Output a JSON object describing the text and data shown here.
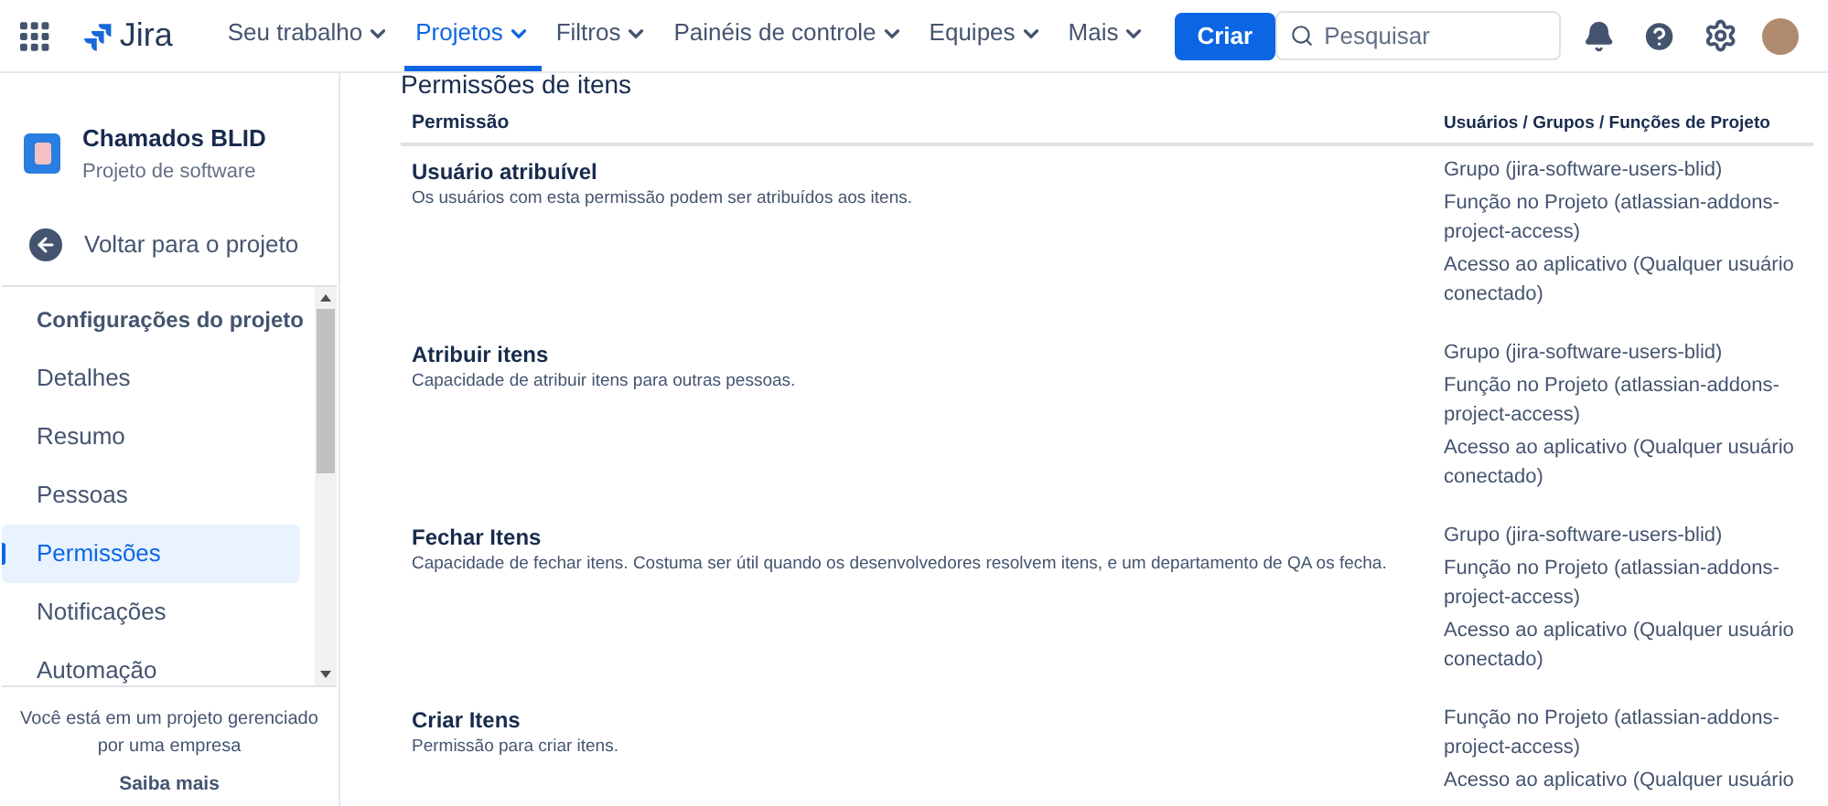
{
  "nav": {
    "product": "Jira",
    "items": [
      {
        "label": "Seu trabalho",
        "selected": false
      },
      {
        "label": "Projetos",
        "selected": true
      },
      {
        "label": "Filtros",
        "selected": false
      },
      {
        "label": "Painéis de controle",
        "selected": false
      },
      {
        "label": "Equipes",
        "selected": false
      },
      {
        "label": "Mais",
        "selected": false
      }
    ],
    "create": "Criar",
    "search": {
      "placeholder": "Pesquisar"
    }
  },
  "sidebar": {
    "project": {
      "name": "Chamados BLID",
      "type": "Projeto de software"
    },
    "back": "Voltar para o projeto",
    "section": "Configurações do projeto",
    "items": [
      {
        "label": "Detalhes",
        "selected": false
      },
      {
        "label": "Resumo",
        "selected": false
      },
      {
        "label": "Pessoas",
        "selected": false
      },
      {
        "label": "Permissões",
        "selected": true
      },
      {
        "label": "Notificações",
        "selected": false
      },
      {
        "label": "Automação",
        "selected": false
      }
    ],
    "footer": "Você está em um projeto gerenciado por uma empresa",
    "footer_link": "Saiba mais"
  },
  "main": {
    "title": "Permissões de itens",
    "columns": [
      "Permissão",
      "Usuários / Grupos / Funções de Projeto"
    ],
    "rows": [
      {
        "name": "Usuário atribuível",
        "description": "Os usuários com esta permissão podem ser atribuídos aos itens.",
        "grants": [
          "Grupo (jira-software-users-blid)",
          "Função no Projeto (atlassian-addons-project-access)",
          "Acesso ao aplicativo (Qualquer usuário conectado)"
        ]
      },
      {
        "name": "Atribuir itens",
        "description": "Capacidade de atribuir itens para outras pessoas.",
        "grants": [
          "Grupo (jira-software-users-blid)",
          "Função no Projeto (atlassian-addons-project-access)",
          "Acesso ao aplicativo (Qualquer usuário conectado)"
        ]
      },
      {
        "name": "Fechar Itens",
        "description": "Capacidade de fechar itens. Costuma ser útil quando os desenvolvedores resolvem itens, e um departamento de QA os fecha.",
        "grants": [
          "Grupo (jira-software-users-blid)",
          "Função no Projeto (atlassian-addons-project-access)",
          "Acesso ao aplicativo (Qualquer usuário conectado)"
        ]
      },
      {
        "name": "Criar Itens",
        "description": "Permissão para criar itens.",
        "grants": [
          "Função no Projeto (atlassian-addons-project-access)",
          "Acesso ao aplicativo (Qualquer usuário"
        ]
      }
    ]
  }
}
